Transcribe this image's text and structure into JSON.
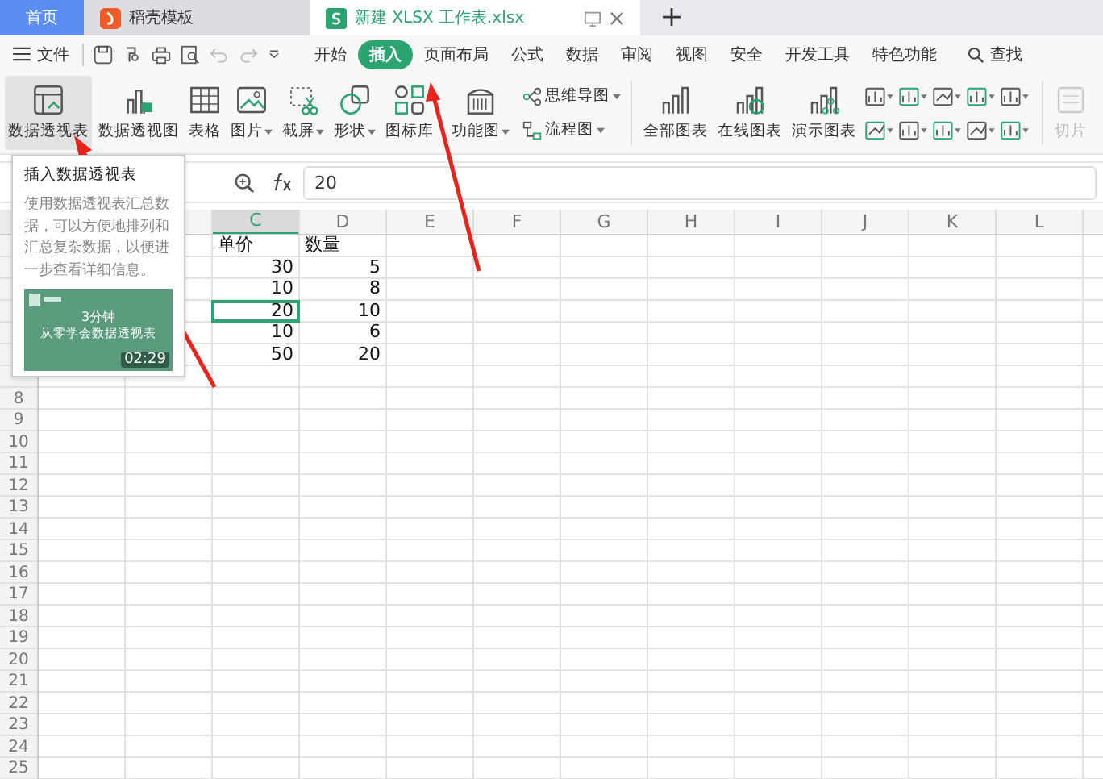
{
  "tabs": [
    {
      "label": "首页",
      "kind": "home",
      "selected": false
    },
    {
      "label": "稻壳模板",
      "kind": "docer",
      "selected": false
    },
    {
      "label": "新建 XLSX 工作表.xlsx",
      "kind": "sheet",
      "selected": true
    }
  ],
  "menu": {
    "file": "文件",
    "tabs": [
      {
        "label": "开始",
        "selected": false
      },
      {
        "label": "插入",
        "selected": true
      },
      {
        "label": "页面布局",
        "selected": false
      },
      {
        "label": "公式",
        "selected": false
      },
      {
        "label": "数据",
        "selected": false
      },
      {
        "label": "审阅",
        "selected": false
      },
      {
        "label": "视图",
        "selected": false
      },
      {
        "label": "安全",
        "selected": false
      },
      {
        "label": "开发工具",
        "selected": false
      },
      {
        "label": "特色功能",
        "selected": false
      }
    ],
    "search": "查找"
  },
  "ribbon": [
    {
      "label": "数据透视表",
      "kind": "pivot",
      "dropdown": false,
      "selected": true,
      "disabled": false
    },
    {
      "label": "数据透视图",
      "kind": "pivotchart",
      "dropdown": false,
      "selected": false,
      "disabled": false
    },
    {
      "label": "表格",
      "kind": "table",
      "dropdown": false,
      "selected": false,
      "disabled": false
    },
    {
      "label": "图片",
      "kind": "picture",
      "dropdown": true,
      "selected": false,
      "disabled": false
    },
    {
      "label": "截屏",
      "kind": "screenshot",
      "dropdown": true,
      "selected": false,
      "disabled": false
    },
    {
      "label": "形状",
      "kind": "shape",
      "dropdown": true,
      "selected": false,
      "disabled": false
    },
    {
      "label": "图标库",
      "kind": "iconlib",
      "dropdown": false,
      "selected": false,
      "disabled": false
    },
    {
      "label": "功能图",
      "kind": "barcode",
      "dropdown": true,
      "selected": false,
      "disabled": false
    },
    {
      "label": "思维导图",
      "kind": "mindmap",
      "dropdown": true,
      "selected": false,
      "disabled": false
    },
    {
      "label": "流程图",
      "kind": "flowchart",
      "dropdown": true,
      "selected": false,
      "disabled": false
    },
    {
      "label": "全部图表",
      "kind": "chart",
      "dropdown": false,
      "selected": false,
      "disabled": false
    },
    {
      "label": "在线图表",
      "kind": "onlinechart",
      "dropdown": false,
      "selected": false,
      "disabled": false
    },
    {
      "label": "演示图表",
      "kind": "demochart",
      "dropdown": false,
      "selected": false,
      "disabled": false
    },
    {
      "label": "切片",
      "kind": "slicer",
      "dropdown": false,
      "selected": false,
      "disabled": true
    }
  ],
  "tooltip": {
    "title": "插入数据透视表",
    "body": "使用数据透视表汇总数据，可以方便地排列和汇总复杂数据，以便进一步查看详细信息。",
    "video": {
      "heading": "3分钟",
      "subtitle": "从零学会数据透视表",
      "duration": "02:29"
    }
  },
  "formula_bar": {
    "value": "20"
  },
  "sheet": {
    "columns": [
      {
        "label": "C",
        "selected": true
      },
      {
        "label": "D",
        "selected": false
      },
      {
        "label": "E",
        "selected": false
      },
      {
        "label": "F",
        "selected": false
      },
      {
        "label": "G",
        "selected": false
      },
      {
        "label": "H",
        "selected": false
      },
      {
        "label": "I",
        "selected": false
      },
      {
        "label": "J",
        "selected": false
      },
      {
        "label": "K",
        "selected": false
      },
      {
        "label": "L",
        "selected": false
      }
    ],
    "row_numbers": [
      "8",
      "9",
      "10",
      "11",
      "12",
      "13",
      "14",
      "15",
      "16",
      "17",
      "18",
      "19",
      "20",
      "21",
      "22",
      "23",
      "24",
      "25"
    ],
    "rows": [
      {
        "cells": [
          {
            "text": "单价",
            "kind": "text",
            "selected": false
          },
          {
            "text": "数量",
            "kind": "text",
            "selected": false
          }
        ]
      },
      {
        "cells": [
          {
            "text": "30",
            "kind": "number",
            "selected": false
          },
          {
            "text": "5",
            "kind": "number",
            "selected": false
          }
        ]
      },
      {
        "cells": [
          {
            "text": "10",
            "kind": "number",
            "selected": false
          },
          {
            "text": "8",
            "kind": "number",
            "selected": false
          }
        ]
      },
      {
        "cells": [
          {
            "text": "20",
            "kind": "number",
            "selected": true
          },
          {
            "text": "10",
            "kind": "number",
            "selected": false
          }
        ]
      },
      {
        "cells": [
          {
            "text": "10",
            "kind": "number",
            "selected": false
          },
          {
            "text": "6",
            "kind": "number",
            "selected": false
          }
        ]
      },
      {
        "cells": [
          {
            "text": "50",
            "kind": "number",
            "selected": false
          },
          {
            "text": "20",
            "kind": "number",
            "selected": false
          }
        ]
      }
    ]
  }
}
